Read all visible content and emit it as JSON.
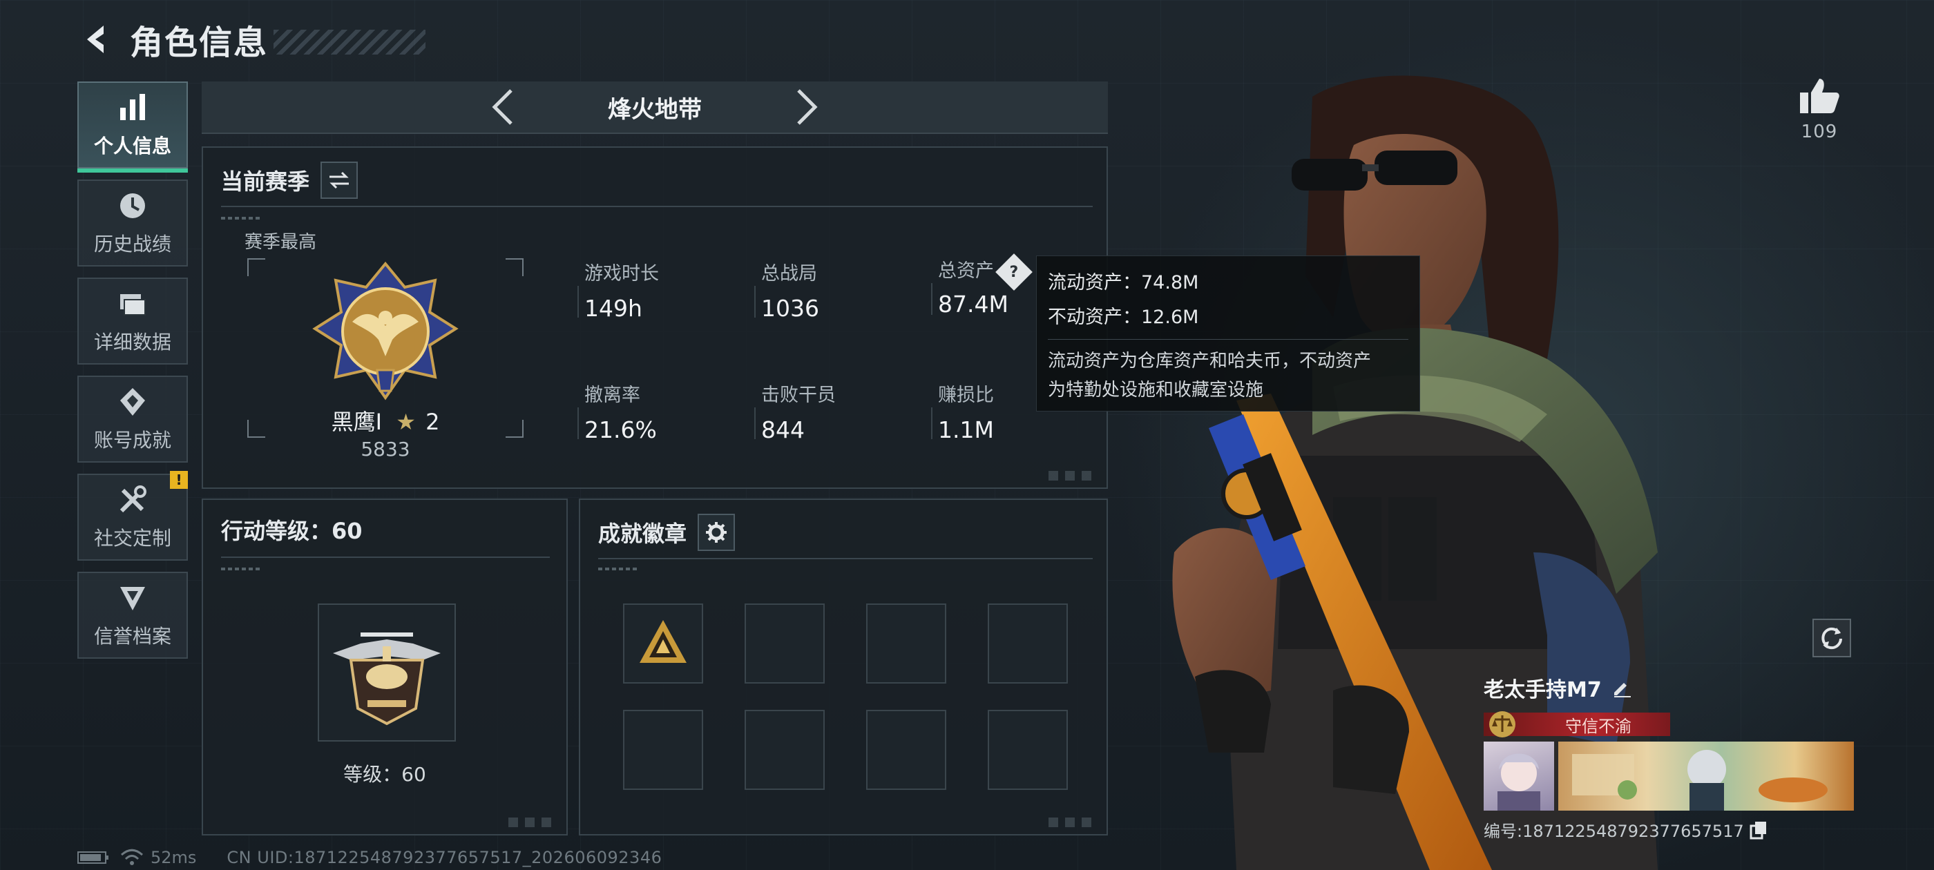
{
  "header": {
    "title": "角色信息"
  },
  "sidebar": {
    "items": [
      {
        "label": "个人信息",
        "icon": "bar-chart-icon",
        "active": true
      },
      {
        "label": "历史战绩",
        "icon": "clock-icon"
      },
      {
        "label": "详细数据",
        "icon": "folder-icon"
      },
      {
        "label": "账号成就",
        "icon": "medal-icon"
      },
      {
        "label": "社交定制",
        "icon": "tools-icon",
        "badge": "!"
      },
      {
        "label": "信誉档案",
        "icon": "shield-rank-icon"
      }
    ]
  },
  "mode": {
    "name": "烽火地带"
  },
  "season": {
    "title": "当前赛季",
    "best_label": "赛季最高",
    "rank_name": "黑鹰I",
    "rank_stars": "2",
    "rank_score": "5833",
    "stats": [
      {
        "label": "游戏时长",
        "value": "149h"
      },
      {
        "label": "总战局",
        "value": "1036"
      },
      {
        "label": "总资产",
        "value": "87.4M"
      },
      {
        "label": "撤离率",
        "value": "21.6%"
      },
      {
        "label": "击败干员",
        "value": "844"
      },
      {
        "label": "赚损比",
        "value": "1.1M"
      }
    ]
  },
  "tooltip": {
    "liquid": "流动资产：74.8M",
    "fixed": "不动资产：12.6M",
    "desc_line1": "流动资产为仓库资产和哈夫币，不动资产",
    "desc_line2": "为特勤处设施和收藏室设施"
  },
  "level": {
    "title": "行动等级：60",
    "label": "等级：60"
  },
  "achievements": {
    "title": "成就徽章"
  },
  "player": {
    "likes": "109",
    "name": "老太手持M7",
    "title_badge": "守信不渝",
    "id_text": "编号:1871225487923776575​17"
  },
  "footer": {
    "ping": "52ms",
    "uid": "CN UID:1871225487923776575​17_202606092346"
  },
  "colors": {
    "accent": "#3fc79a",
    "warning": "#e8b420",
    "title_badge": "#b0242a"
  }
}
